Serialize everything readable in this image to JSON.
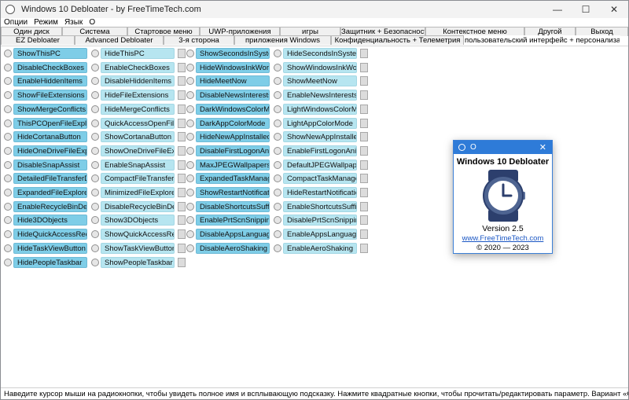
{
  "window": {
    "title": "Windows 10 Debloater - by FreeTimeTech.com",
    "minimize_glyph": "—",
    "maximize_glyph": "☐",
    "close_glyph": "✕"
  },
  "menu": [
    "Опции",
    "Режим",
    "Язык",
    "O"
  ],
  "tabs_row1": [
    "Один диск",
    "Система",
    "Стартовое меню",
    "UWP-приложения",
    "игры",
    "Защитник + Безопасность",
    "Контекстное меню",
    "Другой",
    "Выход"
  ],
  "tabs_row2": [
    "EZ Debloater",
    "Advanced Debloater",
    "3-я сторона",
    "приложения Windows",
    "Конфиденциальность + Телеметрия",
    "пользовательский интерфейс + персонализация"
  ],
  "active_tab": "пользовательский интерфейс + персонализация",
  "groups": [
    {
      "left": [
        "ShowThisPC",
        "DisableCheckBoxes",
        "EnableHiddenItems",
        "ShowFileExtensions",
        "ShowMergeConflicts",
        "ThisPCOpenFileExplorerTo",
        "HideCortanaButton",
        "HideOneDriveFileExplorerAd",
        "DisableSnapAssist",
        "DetailedFileTransferDialog",
        "ExpandedFileExplorerRibbon",
        "EnableRecycleBinDeleteConfir",
        "Hide3DObjects",
        "HideQuickAccessRecentFiles",
        "HideTaskViewButton",
        "HidePeopleTaskbar"
      ],
      "right": [
        "HideThisPC",
        "EnableCheckBoxes",
        "DisableHiddenItems",
        "HideFileExtensions",
        "HideMergeConflicts",
        "QuickAccessOpenFileExplorer",
        "ShowCortanaButton",
        "ShowOneDriveFileExplorerAd",
        "EnableSnapAssist",
        "CompactFileTransferDialog",
        "MinimizedFileExplorerRibbon",
        "DisableRecycleBinDeleteConfi",
        "Show3DObjects",
        "ShowQuickAccessRecentFiles",
        "ShowTaskViewButton",
        "ShowPeopleTaskbar"
      ]
    },
    {
      "left": [
        "ShowSecondsInSystemClock",
        "HideWindowsInkWorkspace",
        "HideMeetNow",
        "DisableNewsInterests",
        "DarkWindowsColorMode",
        "DarkAppColorMode",
        "HideNewAppInstalledNotificat",
        "DisableFirstLogonAnimation",
        "MaxJPEGWallpapersQuality",
        "ExpandedTaskManagerWindo",
        "ShowRestartNotification",
        "DisableShortcutsSuffix",
        "EnablePrtScnSnippingTool",
        "DisableAppsLanguageSwitch",
        "DisableAeroShaking"
      ],
      "right": [
        "HideSecondsInSystemClock",
        "ShowWindowsInkWorkspace",
        "ShowMeetNow",
        "EnableNewsInterests",
        "LightWindowsColorMode",
        "LightAppColorMode",
        "ShowNewAppInstalledNotifica",
        "EnableFirstLogonAnimation",
        "DefaultJPEGWallpapersQuality",
        "CompactTaskManagerWindow",
        "HideRestartNotification",
        "EnableShortcutsSuffix",
        "DisablePrtScnSnippingTool",
        "EnableAppsLanguageSwitch",
        "EnableAeroShaking"
      ]
    }
  ],
  "status_text": "Наведите курсор мыши на радиокнопки, чтобы увидеть полное имя и всплывающую подсказку. Нажмите квадратные кнопки, чтобы прочитать/редактировать параметр. Вариант «Серый» означает, что ничего не выбрано.",
  "about": {
    "title_bar": "O",
    "close_glyph": "✕",
    "heading": "Windows 10 Debloater",
    "version": "Version 2.5",
    "link": "www.FreeTimeTech.com",
    "copyright": "© 2020 — 2023"
  },
  "colors": {
    "option_on": "#7ecde7",
    "option_off": "#b6e5f0",
    "about_titlebar": "#2e7bd8",
    "link": "#1b57c4"
  }
}
